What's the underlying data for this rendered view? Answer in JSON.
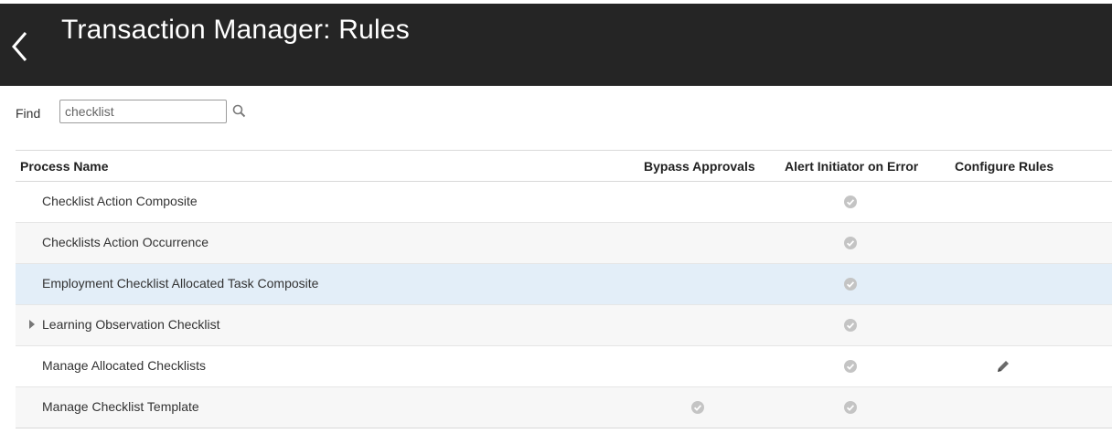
{
  "header": {
    "title": "Transaction Manager: Rules",
    "back_icon": "chevron-left-icon",
    "background": "#252525"
  },
  "find": {
    "label": "Find",
    "value": "checklist",
    "search_icon": "search-icon"
  },
  "table": {
    "columns": [
      "Process Name",
      "Bypass Approvals",
      "Alert Initiator on Error",
      "Configure Rules"
    ],
    "rows": [
      {
        "name": "Checklist Action Composite",
        "bypass_approvals": false,
        "alert_initiator_on_error": true,
        "configure_rules": false,
        "expandable": false,
        "selected": false
      },
      {
        "name": "Checklists Action Occurrence",
        "bypass_approvals": false,
        "alert_initiator_on_error": true,
        "configure_rules": false,
        "expandable": false,
        "selected": false
      },
      {
        "name": "Employment Checklist Allocated Task Composite",
        "bypass_approvals": false,
        "alert_initiator_on_error": true,
        "configure_rules": false,
        "expandable": false,
        "selected": true
      },
      {
        "name": "Learning Observation Checklist",
        "bypass_approvals": false,
        "alert_initiator_on_error": true,
        "configure_rules": false,
        "expandable": true,
        "selected": false
      },
      {
        "name": "Manage Allocated Checklists",
        "bypass_approvals": false,
        "alert_initiator_on_error": true,
        "configure_rules": true,
        "expandable": false,
        "selected": false
      },
      {
        "name": "Manage Checklist Template",
        "bypass_approvals": true,
        "alert_initiator_on_error": true,
        "configure_rules": false,
        "expandable": false,
        "selected": false
      }
    ]
  },
  "colors": {
    "selected_row": "#e3eef8",
    "alt_row": "#f7f7f7",
    "check": "#c4c4c4"
  }
}
